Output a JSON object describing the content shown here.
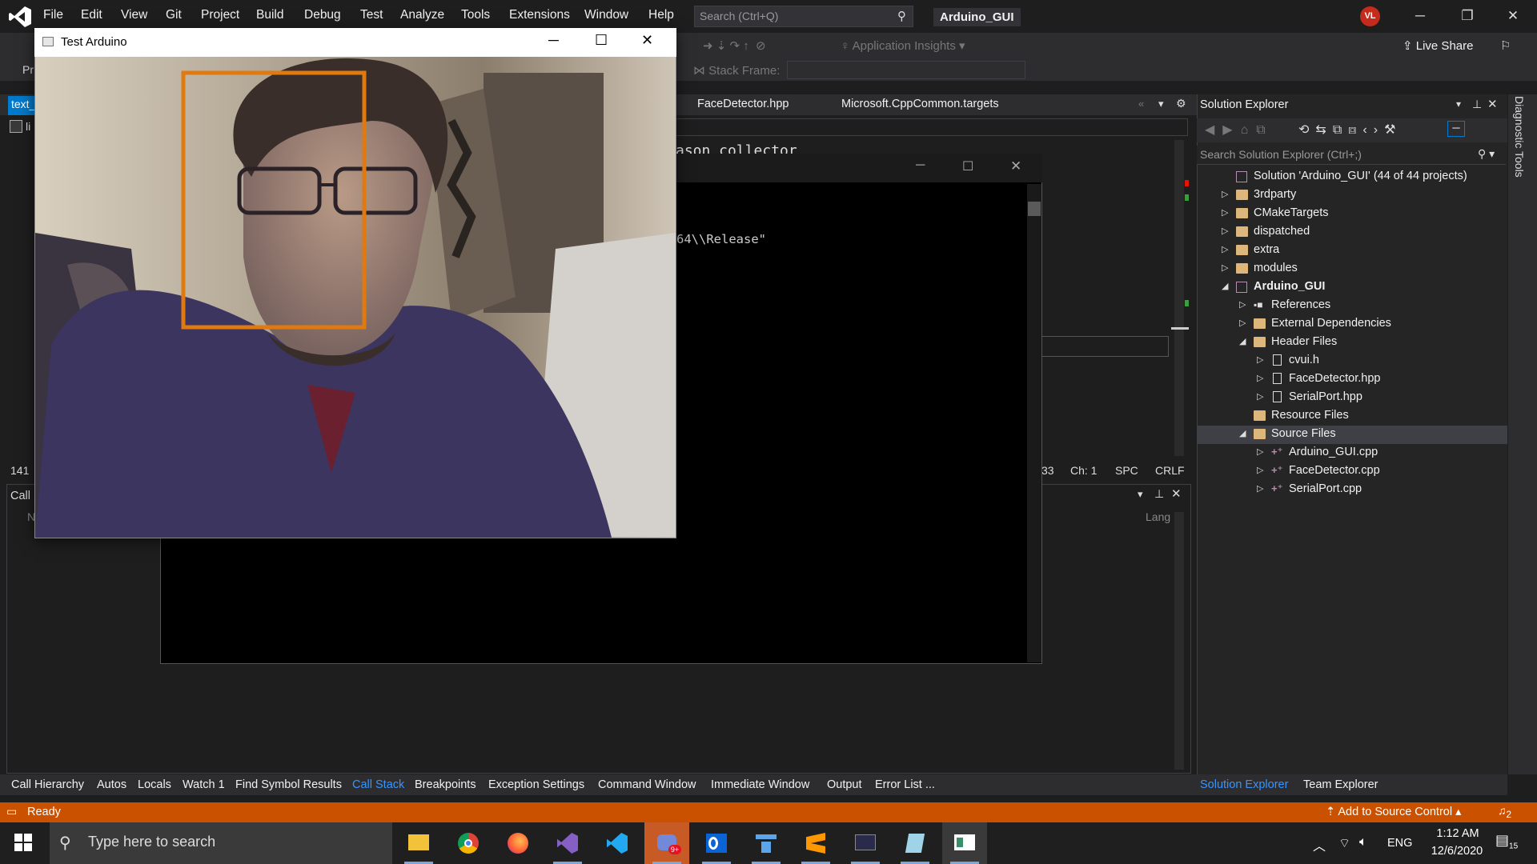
{
  "menubar": {
    "items": [
      "File",
      "Edit",
      "View",
      "Git",
      "Project",
      "Build",
      "Debug",
      "Test",
      "Analyze",
      "Tools",
      "Extensions",
      "Window",
      "Help"
    ],
    "search_placeholder": "Search (Ctrl+Q)",
    "solution_name": "Arduino_GUI",
    "avatar_initials": "VL"
  },
  "toolbar": {
    "app_insights": "Application Insights",
    "stack_frame": "Stack Frame:",
    "live_share": "Live Share",
    "left_fragment": "Pr"
  },
  "editor": {
    "active_tab": "text_",
    "tabs": [
      "FaceDetector.hpp",
      "Microsoft.CppCommon.targets"
    ],
    "code_fragment": "ason collector",
    "status_line_no": "141",
    "status_line_col": "33",
    "status_ch": "Ch: 1",
    "status_spc": "SPC",
    "status_crlf": "CRLF",
    "left_fragment": "li"
  },
  "bottom_panel": {
    "title": "Call",
    "col_left": "N",
    "col_lang": "Lang",
    "tabs": [
      "Call Hierarchy",
      "Autos",
      "Locals",
      "Watch 1",
      "Find Symbol Results",
      "Call Stack",
      "Breakpoints",
      "Exception Settings",
      "Command Window",
      "Immediate Window",
      "Output",
      "Error List ..."
    ],
    "active_tab": "Call Stack"
  },
  "console": {
    "text": "64\\\\Release\""
  },
  "solution_explorer": {
    "title": "Solution Explorer",
    "search_placeholder": "Search Solution Explorer (Ctrl+;)",
    "tree": [
      {
        "label": "Solution 'Arduino_GUI' (44 of 44 projects)",
        "type": "solution"
      },
      {
        "label": "3rdparty",
        "type": "folder"
      },
      {
        "label": "CMakeTargets",
        "type": "folder"
      },
      {
        "label": "dispatched",
        "type": "folder"
      },
      {
        "label": "extra",
        "type": "folder"
      },
      {
        "label": "modules",
        "type": "folder"
      },
      {
        "label": "Arduino_GUI",
        "type": "project"
      },
      {
        "label": "References",
        "type": "refs"
      },
      {
        "label": "External Dependencies",
        "type": "folder"
      },
      {
        "label": "Header Files",
        "type": "folder"
      },
      {
        "label": "cvui.h",
        "type": "file"
      },
      {
        "label": "FaceDetector.hpp",
        "type": "file"
      },
      {
        "label": "SerialPort.hpp",
        "type": "file"
      },
      {
        "label": "Resource Files",
        "type": "folder"
      },
      {
        "label": "Source Files",
        "type": "folder"
      },
      {
        "label": "Arduino_GUI.cpp",
        "type": "cpp"
      },
      {
        "label": "FaceDetector.cpp",
        "type": "cpp"
      },
      {
        "label": "SerialPort.cpp",
        "type": "cpp"
      }
    ],
    "bottom_tabs": [
      "Solution Explorer",
      "Team Explorer"
    ]
  },
  "diagnostic_tools": "Diagnostic Tools",
  "statusbar": {
    "ready": "Ready",
    "source_control": "Add to Source Control",
    "notifications": "2"
  },
  "opencv_window": {
    "title": "Test Arduino"
  },
  "taskbar": {
    "search_placeholder": "Type here to search",
    "language": "ENG",
    "time": "1:12 AM",
    "date": "12/6/2020",
    "notif_count": "15"
  },
  "colors": {
    "accent": "#007acc",
    "status_bar": "#ca5100",
    "face_box": "#e07a10"
  }
}
